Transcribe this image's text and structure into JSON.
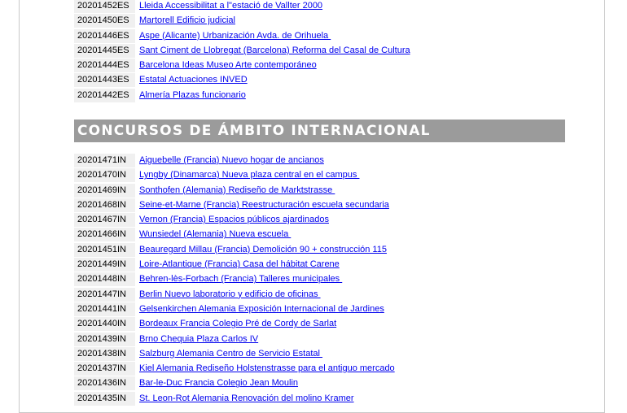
{
  "national_rows": [
    {
      "code": "20201452ES",
      "title": "Lleida Accessibilitat a l\"estació de Vallter 2000"
    },
    {
      "code": "20201450ES",
      "title": "Martorell Edificio judicial"
    },
    {
      "code": "20201446ES",
      "title": "Aspe (Alicante) Urbanización Avda. de Orihuela "
    },
    {
      "code": "20201445ES",
      "title": "Sant Ciment de Llobregat (Barcelona) Reforma del Casal de Cultura"
    },
    {
      "code": "20201444ES",
      "title": "Barcelona Ideas Museo Arte contemporáneo"
    },
    {
      "code": "20201443ES",
      "title": "Estatal Actuaciones INVED"
    },
    {
      "code": "20201442ES",
      "title": "Almería Plazas funcionario"
    }
  ],
  "international_header": "CONCURSOS DE ÁMBITO INTERNACIONAL",
  "international_rows": [
    {
      "code": "20201471IN",
      "title": "Aiguebelle (Francia) Nuevo hogar de ancianos"
    },
    {
      "code": "20201470IN",
      "title": "Lyngby (Dinamarca) Nueva plaza central en el campus "
    },
    {
      "code": "20201469IN",
      "title": "Sonthofen (Alemania) Rediseño de Marktstrasse "
    },
    {
      "code": "20201468IN",
      "title": "Seine-et-Marne (Francia) Reestructuración escuela secundaria"
    },
    {
      "code": "20201467IN",
      "title": "Vernon (Francia) Espacios públicos ajardinados"
    },
    {
      "code": "20201466IN",
      "title": "Wunsiedel (Alemania) Nueva escuela "
    },
    {
      "code": "20201451IN",
      "title": "Beauregard Millau (Francia) Demolición 90 + construcción 115"
    },
    {
      "code": "20201449IN",
      "title": "Loire-Atlantique (Francia) Casa del hábitat Carene"
    },
    {
      "code": "20201448IN",
      "title": "Behren-lès-Forbach (Francia) Talleres municipales "
    },
    {
      "code": "20201447IN",
      "title": "Berlin Nuevo laboratorio y edificio de oficinas "
    },
    {
      "code": "20201441IN",
      "title": "Gelsenkirchen Alemania Exposición Internacional de Jardines"
    },
    {
      "code": "20201440IN",
      "title": "Bordeaux Francia Colegio Pré de Cordy de Sarlat"
    },
    {
      "code": "20201439IN",
      "title": "Brno Chequia Plaza Carlos IV"
    },
    {
      "code": "20201438IN",
      "title": "Salzburg Alemania Centro de Servicio Estatal "
    },
    {
      "code": "20201437IN",
      "title": "Kiel Alemania Rediseño Holstenstrasse para el antiguo mercado"
    },
    {
      "code": "20201436IN",
      "title": "Bar-le-Duc Francia Colegio Jean Moulin"
    },
    {
      "code": "20201435IN",
      "title": "St. Leon-Rot Alemania Renovación del molino Kramer"
    }
  ]
}
